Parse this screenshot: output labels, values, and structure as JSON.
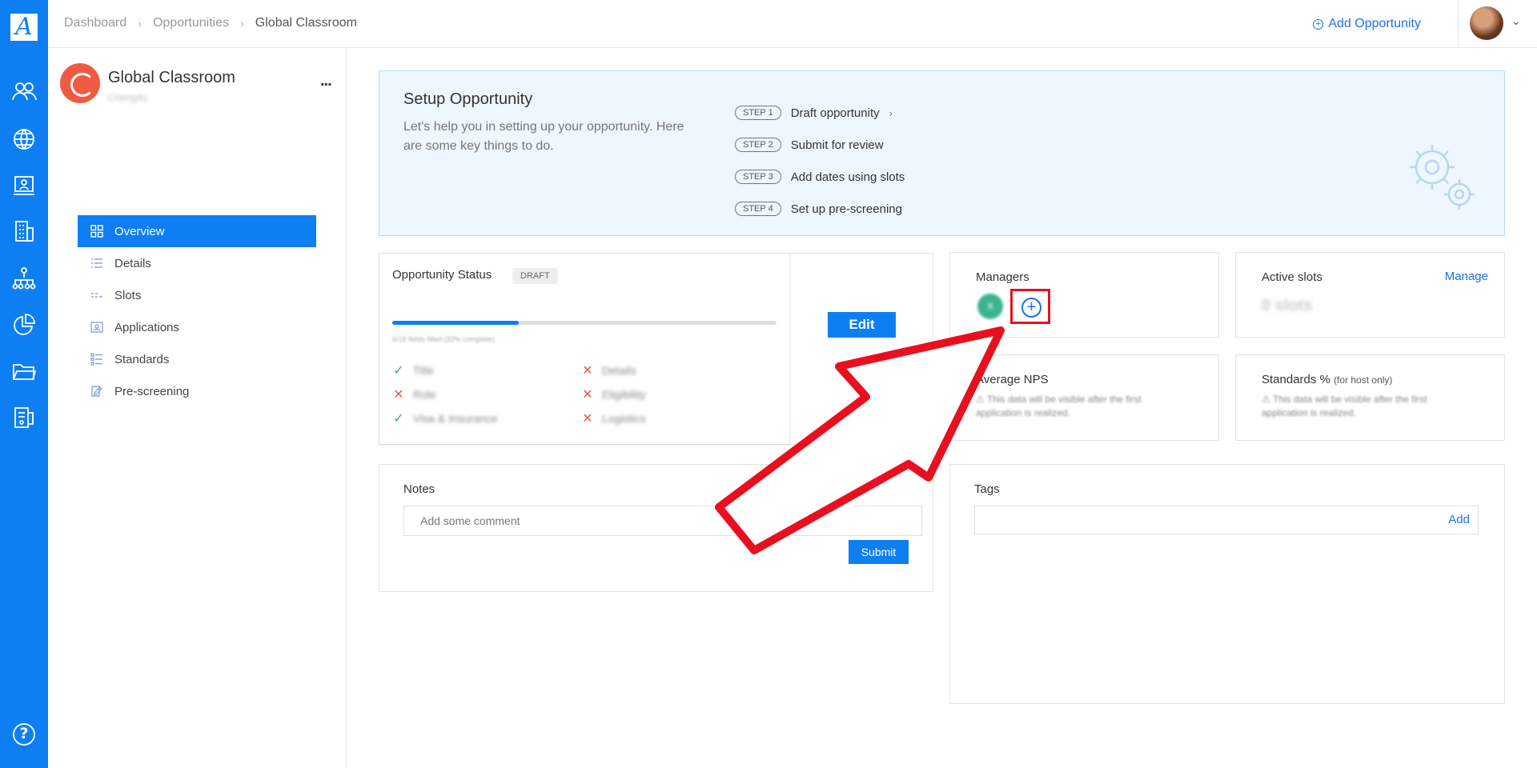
{
  "app": {
    "logo_letter": "A"
  },
  "breadcrumb": {
    "items": [
      "Dashboard",
      "Opportunities",
      "Global Classroom"
    ]
  },
  "header": {
    "add_opportunity_label": "Add Opportunity"
  },
  "rail": {
    "icons": [
      "users-icon",
      "globe-icon",
      "presentation-icon",
      "building-icon",
      "org-chart-icon",
      "pie-chart-icon",
      "folder-icon",
      "document-icon",
      "help-icon"
    ],
    "help_label": "?"
  },
  "org": {
    "name": "Global Classroom",
    "subtitle": "Chengdu",
    "more_label": "..."
  },
  "nav": {
    "items": [
      {
        "label": "Overview",
        "icon": "grid-icon",
        "active": true
      },
      {
        "label": "Details",
        "icon": "list-icon"
      },
      {
        "label": "Slots",
        "icon": "slots-icon"
      },
      {
        "label": "Applications",
        "icon": "applications-icon"
      },
      {
        "label": "Standards",
        "icon": "checklist-icon"
      },
      {
        "label": "Pre-screening",
        "icon": "edit-icon"
      }
    ]
  },
  "setup": {
    "title": "Setup Opportunity",
    "description": "Let's help you in setting up your opportunity. Here are some key things to do.",
    "steps": [
      {
        "badge": "STEP 1",
        "label": "Draft opportunity",
        "arrow": "›"
      },
      {
        "badge": "STEP 2",
        "label": "Submit for review"
      },
      {
        "badge": "STEP 3",
        "label": "Add dates using slots"
      },
      {
        "badge": "STEP 4",
        "label": "Set up pre-screening"
      }
    ]
  },
  "status": {
    "title": "Opportunity Status",
    "badge": "DRAFT",
    "progress_fraction": 0.33,
    "progress_text": "6/18 fields filled (33% complete)",
    "fields": [
      {
        "label": "Title",
        "done": true
      },
      {
        "label": "Details",
        "done": false
      },
      {
        "label": "Role",
        "done": false
      },
      {
        "label": "Eligibility",
        "done": false
      },
      {
        "label": "Visa & Insurance",
        "done": true
      },
      {
        "label": "Logistics",
        "done": false
      }
    ],
    "edit_label": "Edit"
  },
  "managers": {
    "title": "Managers",
    "avatar_initial": "X",
    "add_symbol": "+"
  },
  "active_slots": {
    "title": "Active slots",
    "manage_label": "Manage",
    "value": "0 slots"
  },
  "nps": {
    "title": "Average NPS",
    "warning": "⚠ This data will be visible after the first application is realized."
  },
  "standards": {
    "title": "Standards %",
    "title_note": "(for host only)",
    "warning": "⚠ This data will be visible after the first application is realized."
  },
  "notes": {
    "title": "Notes",
    "placeholder": "Add some comment",
    "submit_label": "Submit"
  },
  "tags": {
    "title": "Tags",
    "add_label": "Add"
  },
  "colors": {
    "primary": "#0d7ff2",
    "highlight": "#e8101f",
    "ok": "#3cb371",
    "error": "#ef5a43"
  }
}
